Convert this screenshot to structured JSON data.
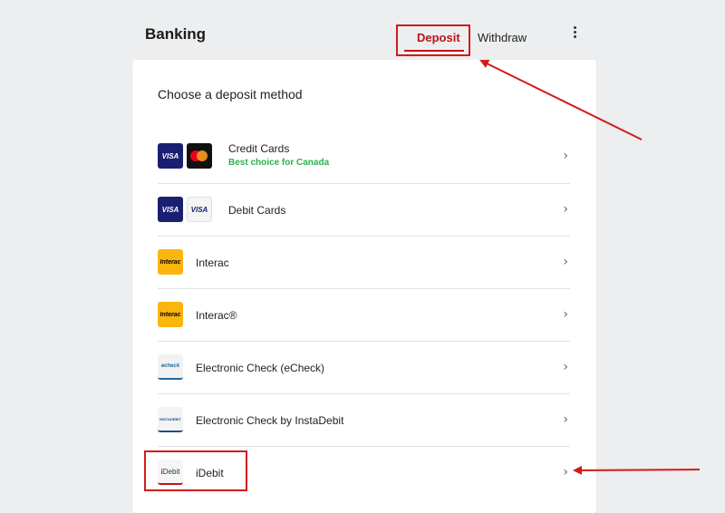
{
  "header": {
    "title": "Banking",
    "tabs": [
      {
        "label": "Deposit",
        "active": true
      },
      {
        "label": "Withdraw",
        "active": false
      }
    ]
  },
  "card": {
    "title": "Choose a deposit method",
    "methods": [
      {
        "label": "Credit Cards",
        "subtitle": "Best choice for Canada",
        "icons": [
          "visa-logo",
          "mastercard-logo"
        ]
      },
      {
        "label": "Debit Cards",
        "icons": [
          "visa-logo",
          "visa-debit-logo"
        ]
      },
      {
        "label": "Interac",
        "icons": [
          "interac-logo"
        ]
      },
      {
        "label": "Interac®",
        "icons": [
          "interac-logo"
        ]
      },
      {
        "label": "Electronic Check (eCheck)",
        "icons": [
          "echeck-logo"
        ]
      },
      {
        "label": "Electronic Check by InstaDebit",
        "icons": [
          "instadebit-logo"
        ]
      },
      {
        "label": "iDebit",
        "icons": [
          "idebit-logo"
        ]
      }
    ]
  },
  "logos": {
    "visa": "VISA",
    "interac": "Interac",
    "echeck": "echeck",
    "insta": "INSTADEBIT",
    "idebit_i": "i",
    "idebit_rest": "Debit"
  },
  "colors": {
    "accent": "#c0121b",
    "annotation": "#d11b1b",
    "success": "#2ab24a",
    "background": "#eceeef"
  }
}
